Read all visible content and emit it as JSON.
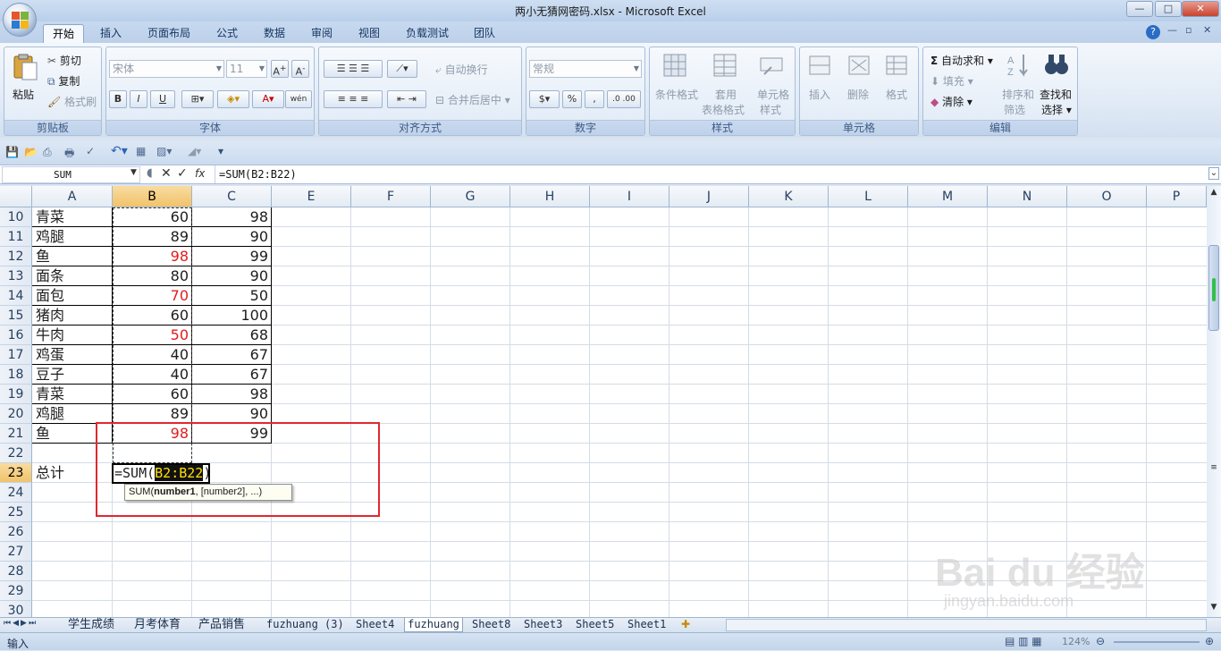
{
  "window": {
    "title": "两小无猜网密码.xlsx - Microsoft Excel",
    "min": "—",
    "max": "□",
    "close": "✕"
  },
  "ribbon_tabs": [
    "开始",
    "插入",
    "页面布局",
    "公式",
    "数据",
    "审阅",
    "视图",
    "负载测试",
    "团队"
  ],
  "ribbon": {
    "clipboard": {
      "paste": "粘贴",
      "cut": "剪切",
      "copy": "复制",
      "format_painter": "格式刷",
      "label": "剪贴板"
    },
    "font": {
      "name": "宋体",
      "size": "11",
      "label": "字体",
      "bold": "B",
      "italic": "I",
      "underline": "U",
      "wen": "wén"
    },
    "alignment": {
      "wrap": "自动换行",
      "merge": "合并后居中",
      "label": "对齐方式"
    },
    "number": {
      "format": "常规",
      "label": "数字",
      "percent": "%",
      "comma": ","
    },
    "styles": {
      "cond": "条件格式",
      "table1": "套用",
      "table2": "表格格式",
      "cell_style1": "单元格",
      "cell_style2": "样式",
      "label": "样式"
    },
    "cells": {
      "insert": "插入",
      "delete": "删除",
      "format": "格式",
      "label": "单元格"
    },
    "editing": {
      "autosum": "自动求和",
      "fill": "填充",
      "clear": "清除",
      "sort1": "排序和",
      "sort2": "筛选",
      "find1": "查找和",
      "find2": "选择",
      "label": "编辑"
    }
  },
  "formula_bar": {
    "name_box": "SUM",
    "formula": "=SUM(B2:B22)",
    "fx": "fx"
  },
  "columns": [
    "A",
    "B",
    "C",
    "E",
    "F",
    "G",
    "H",
    "I",
    "J",
    "K",
    "L",
    "M",
    "N",
    "O",
    "P"
  ],
  "rows": [
    {
      "n": "10",
      "a": "青菜",
      "b": "60",
      "c": "98",
      "b_red": false
    },
    {
      "n": "11",
      "a": "鸡腿",
      "b": "89",
      "c": "90",
      "b_red": false
    },
    {
      "n": "12",
      "a": "鱼",
      "b": "98",
      "c": "99",
      "b_red": true
    },
    {
      "n": "13",
      "a": "面条",
      "b": "80",
      "c": "90",
      "b_red": false
    },
    {
      "n": "14",
      "a": "面包",
      "b": "70",
      "c": "50",
      "b_red": true
    },
    {
      "n": "15",
      "a": "猪肉",
      "b": "60",
      "c": "100",
      "b_red": false
    },
    {
      "n": "16",
      "a": "牛肉",
      "b": "50",
      "c": "68",
      "b_red": true
    },
    {
      "n": "17",
      "a": "鸡蛋",
      "b": "40",
      "c": "67",
      "b_red": false
    },
    {
      "n": "18",
      "a": "豆子",
      "b": "40",
      "c": "67",
      "b_red": false
    },
    {
      "n": "19",
      "a": "青菜",
      "b": "60",
      "c": "98",
      "b_red": false
    },
    {
      "n": "20",
      "a": "鸡腿",
      "b": "89",
      "c": "90",
      "b_red": false
    },
    {
      "n": "21",
      "a": "鱼",
      "b": "98",
      "c": "99",
      "b_red": true
    },
    {
      "n": "22",
      "a": "",
      "b": "",
      "c": "",
      "b_red": false
    },
    {
      "n": "23",
      "a": "总计",
      "b": "",
      "c": "",
      "b_red": false
    },
    {
      "n": "24",
      "a": "",
      "b": "",
      "c": "",
      "b_red": false
    },
    {
      "n": "25",
      "a": "",
      "b": "",
      "c": "",
      "b_red": false
    },
    {
      "n": "26",
      "a": "",
      "b": "",
      "c": "",
      "b_red": false
    },
    {
      "n": "27",
      "a": "",
      "b": "",
      "c": "",
      "b_red": false
    },
    {
      "n": "28",
      "a": "",
      "b": "",
      "c": "",
      "b_red": false
    },
    {
      "n": "29",
      "a": "",
      "b": "",
      "c": "",
      "b_red": false
    },
    {
      "n": "30",
      "a": "",
      "b": "",
      "c": "",
      "b_red": false
    }
  ],
  "editing_cell": {
    "prefix": "=SUM(",
    "ref": "B2:B22",
    "suffix": ")"
  },
  "tooltip": {
    "fn": "SUM(",
    "arg1": "number1",
    "rest": ", [number2], ...)"
  },
  "sheet_tabs": [
    "学生成绩",
    "月考体育",
    "产品销售",
    "fuzhuang (3)",
    "Sheet4",
    "fuzhuang",
    "Sheet8",
    "Sheet3",
    "Sheet5",
    "Sheet1"
  ],
  "active_sheet": "fuzhuang",
  "status": {
    "mode": "输入",
    "zoom": "124%"
  },
  "watermark": {
    "brand": "Bai du 经验",
    "url": "jingyan.baidu.com"
  },
  "colors": {
    "accent": "#f1c26a",
    "highlight_box": "#e0282e",
    "red_value": "#e11c1c"
  }
}
